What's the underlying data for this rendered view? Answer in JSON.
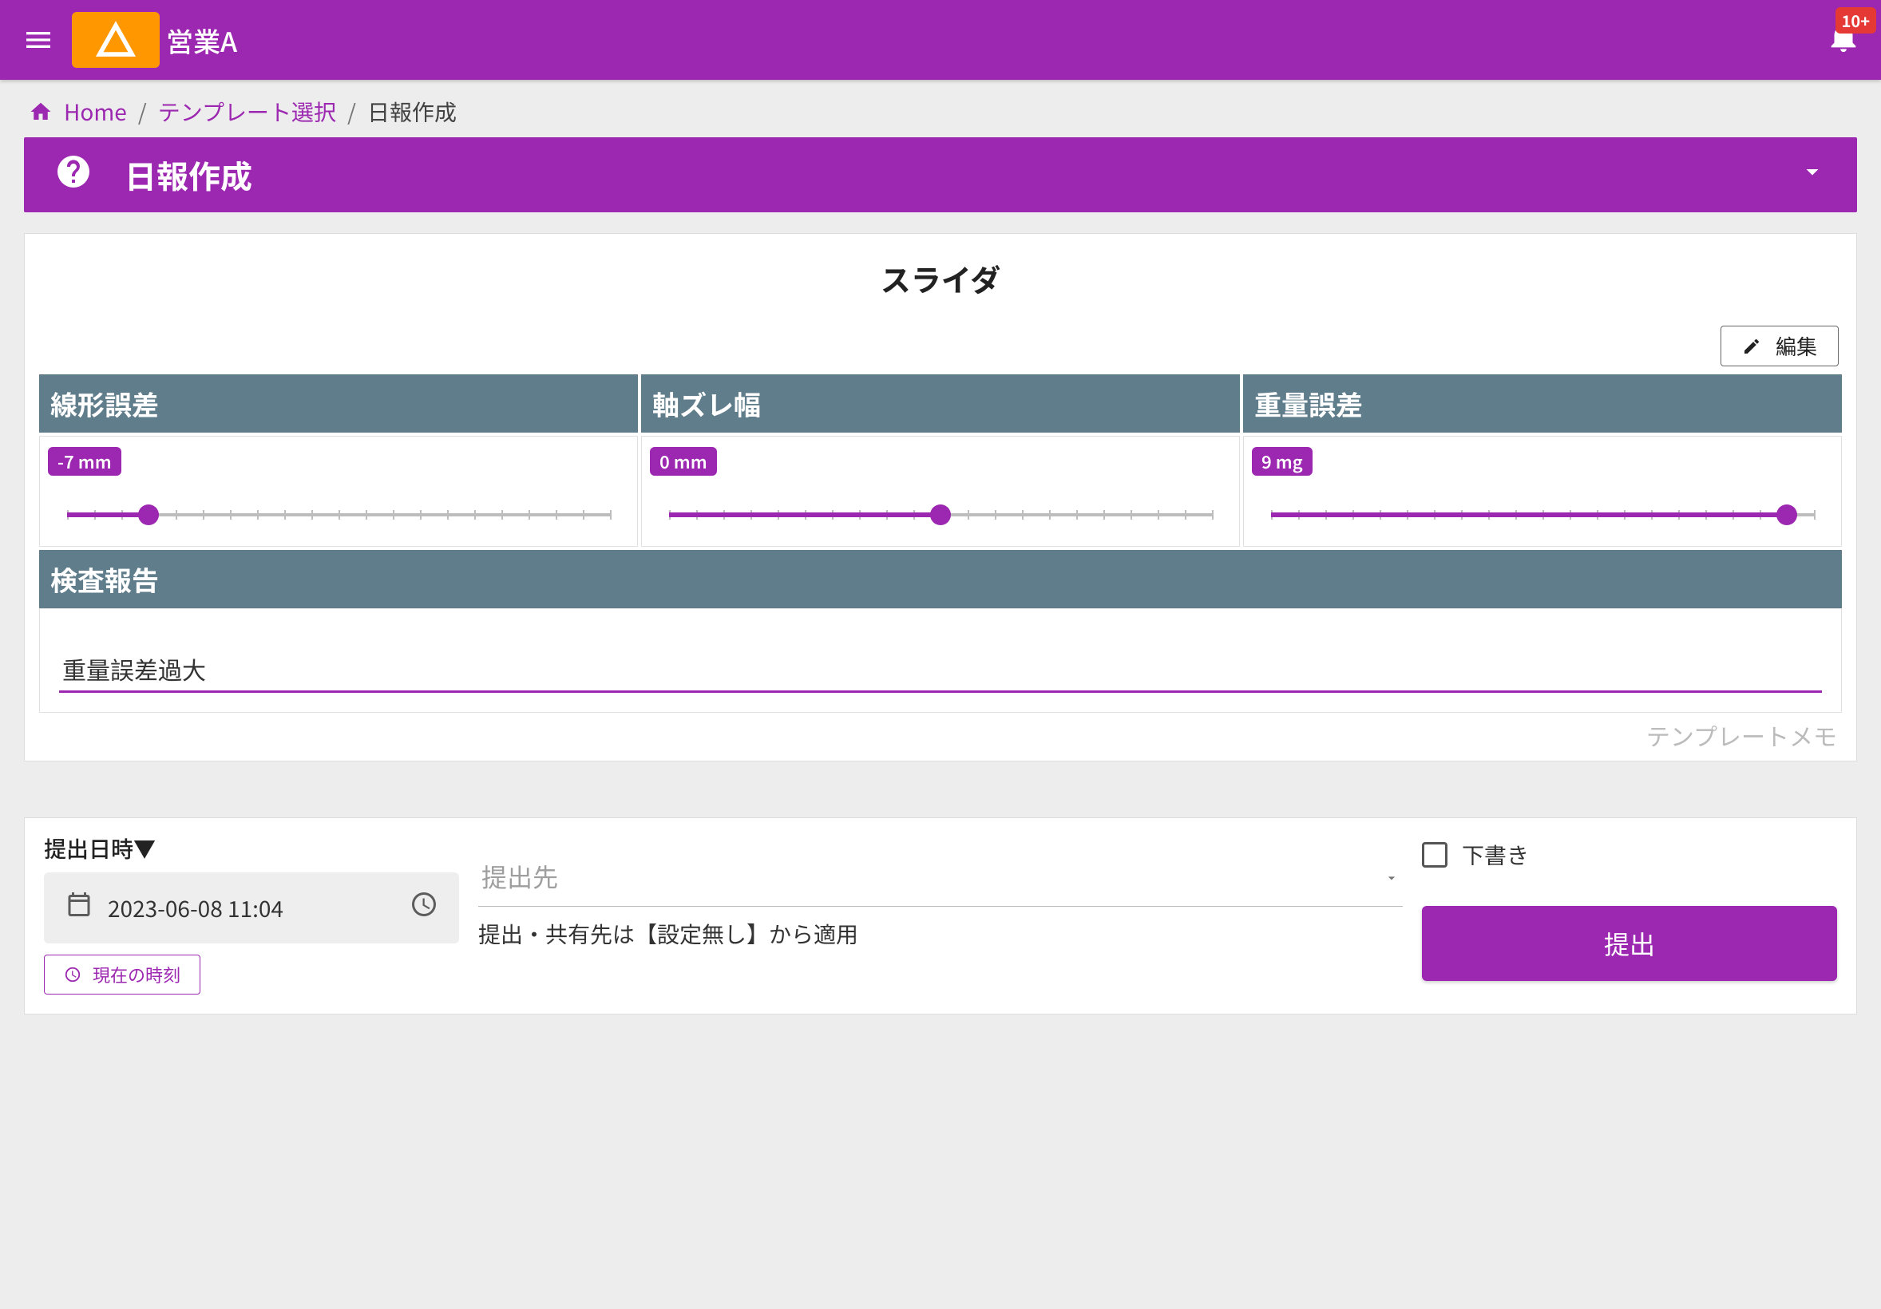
{
  "appbar": {
    "title": "営業A",
    "notification_badge": "10+"
  },
  "breadcrumbs": {
    "home": "Home",
    "template_select": "テンプレート選択",
    "current": "日報作成"
  },
  "titlebar": {
    "title": "日報作成"
  },
  "section": {
    "title": "スライダ",
    "edit_label": "編集"
  },
  "sliders": [
    {
      "label": "線形誤差",
      "value_label": "-7 mm",
      "fill_pct": 15,
      "thumb_pct": 15
    },
    {
      "label": "軸ズレ幅",
      "value_label": "0 mm",
      "fill_pct": 50,
      "thumb_pct": 50
    },
    {
      "label": "重量誤差",
      "value_label": "9 mg",
      "fill_pct": 95,
      "thumb_pct": 95
    }
  ],
  "report": {
    "header": "検査報告",
    "value": "重量誤差過大"
  },
  "template_memo": "テンプレートメモ",
  "footer": {
    "datetime_label": "提出日時▼",
    "datetime_value": "2023-06-08 11:04",
    "now_label": "現在の時刻",
    "dest_placeholder": "提出先",
    "dest_note": "提出・共有先は【設定無し】から適用",
    "draft_label": "下書き",
    "submit_label": "提出"
  }
}
